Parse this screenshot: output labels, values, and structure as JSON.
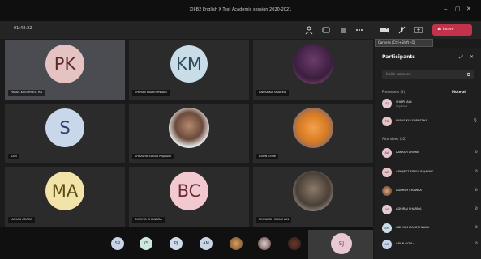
{
  "window": {
    "title": "XII-B2 English X Test Academic session 2020-2021"
  },
  "toolbar": {
    "timer": "01:48:22",
    "leave_label": "Leave",
    "tooltip": "Camera (Ctrl+Shift+O)"
  },
  "tiles": [
    {
      "initials": "PK",
      "name": "PARAS KULSHRESTHA"
    },
    {
      "initials": "KM",
      "name": "KHUSHI MAHESHWARI"
    },
    {
      "initials": "",
      "name": "ANUSHKA SHARMA"
    },
    {
      "initials": "S",
      "name": "SAM"
    },
    {
      "initials": "",
      "name": "SHRAVYA SINGH RAJAWAT"
    },
    {
      "initials": "",
      "name": "ARUN JOSHI"
    },
    {
      "initials": "MA",
      "name": "MAHAK ARORA"
    },
    {
      "initials": "BC",
      "name": "BHUVYA CHANDRA"
    },
    {
      "initials": "",
      "name": "PRIYANSH CHAUHAN"
    }
  ],
  "bottom": {
    "chips": [
      "SR",
      "KS",
      "PJ",
      "AM"
    ],
    "self_initials": "SJ"
  },
  "panel": {
    "title": "Participants",
    "search_placeholder": "Invite someone",
    "presenters_header": "Presenters (2)",
    "mute_all": "Mute all",
    "attendees_header": "Attendees (32)",
    "presenters": [
      {
        "initials": "SJ",
        "name": "SHILPI JAIN",
        "sub": "Organiser"
      },
      {
        "initials": "PK",
        "name": "PARAS KULSHRESTHA",
        "sub": ""
      }
    ],
    "attendees": [
      {
        "initials": "AA",
        "name": "AAKASH ARORA"
      },
      {
        "initials": "AR",
        "name": "ABHIJEET SINGH RAJAWAT"
      },
      {
        "initials": "AC",
        "name": "ADARSH CHAWLA"
      },
      {
        "initials": "AS",
        "name": "ADHIRAJ SHARMA"
      },
      {
        "initials": "AM",
        "name": "ADHYAN MAHESHWARI"
      },
      {
        "initials": "AG",
        "name": "ARUN GOYLA"
      }
    ]
  }
}
